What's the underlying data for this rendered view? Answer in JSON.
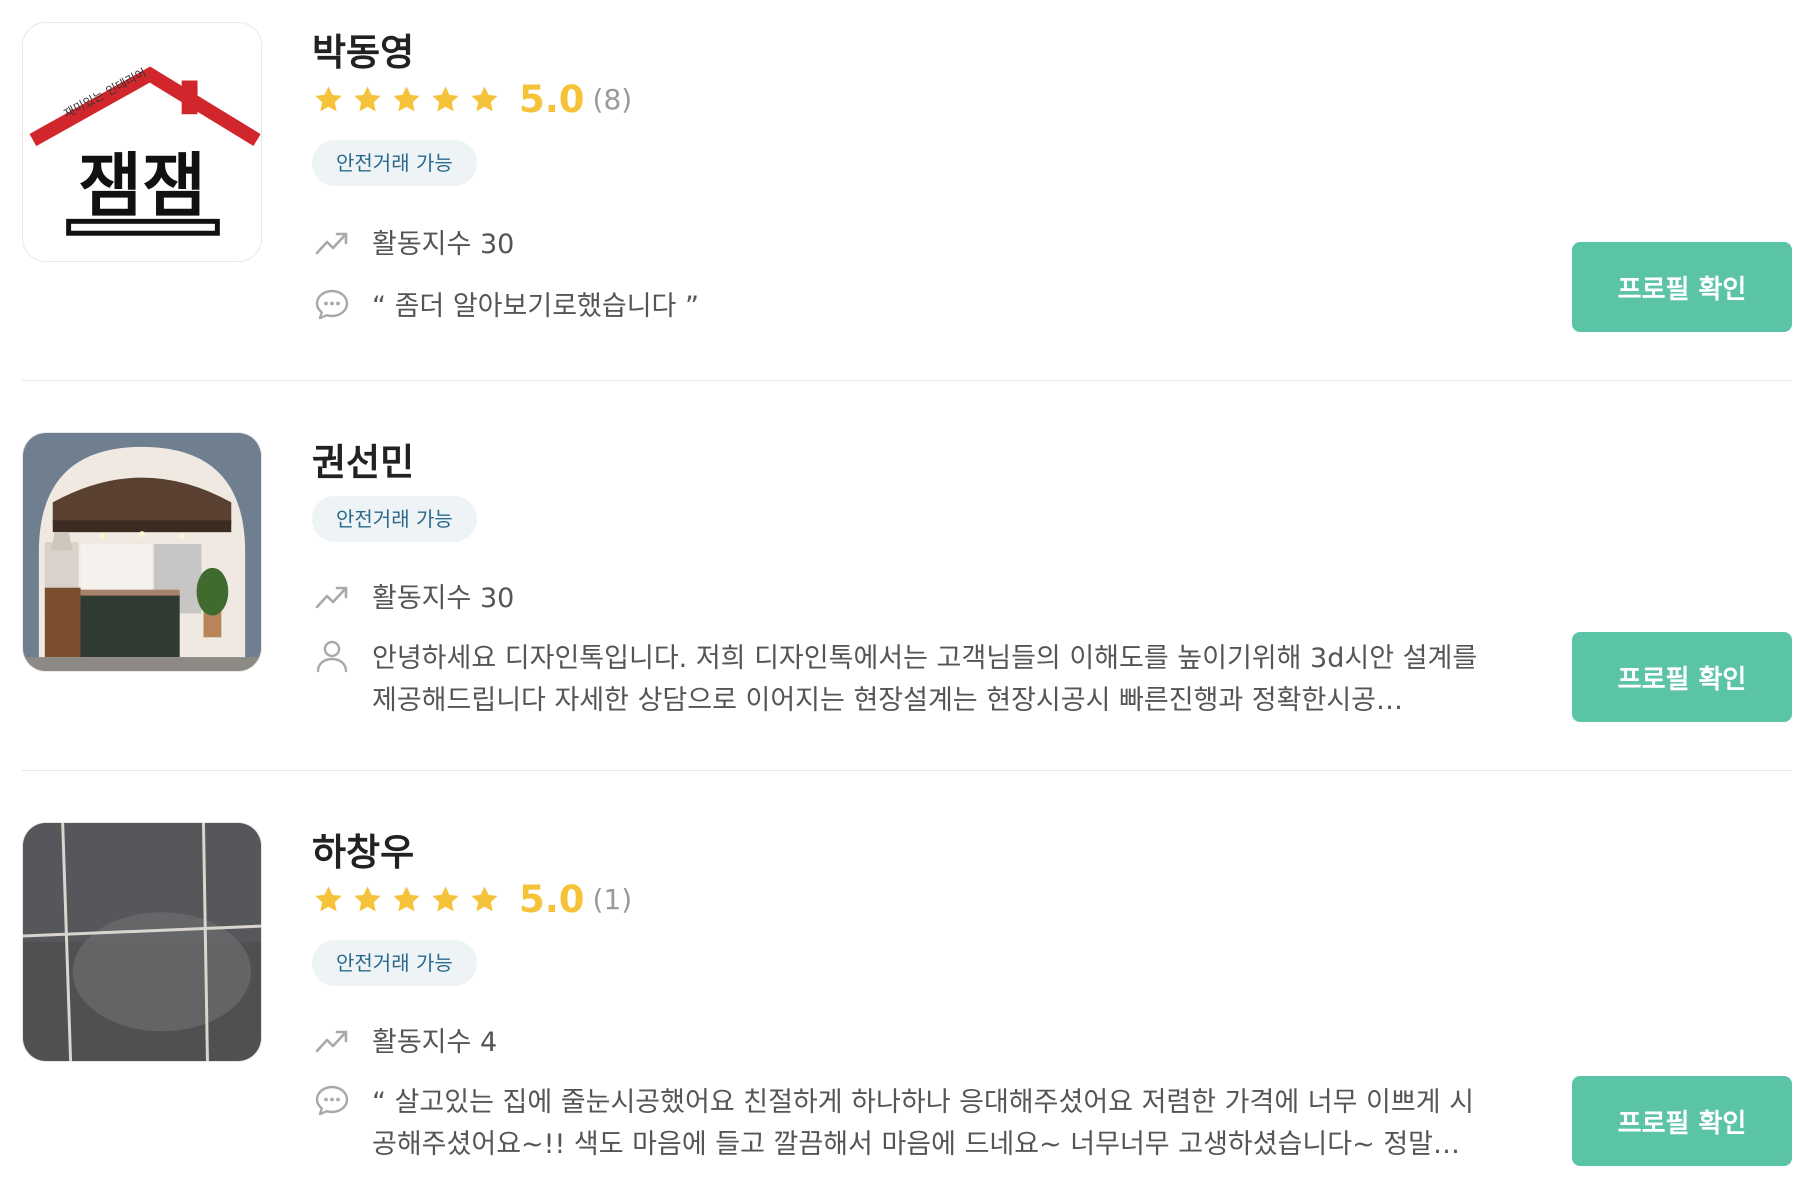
{
  "colors": {
    "accent_button": "#5cc4a6",
    "star": "#f5c23a",
    "badge_bg": "#eef3f6",
    "badge_text": "#2b6a8c",
    "divider": "#e6e6e6"
  },
  "experts": [
    {
      "name": "박동영",
      "avatar_icon": "jaemjaem-house-logo",
      "avatar_logo_text": "잼잼",
      "avatar_logo_subtext": "재미있는 인테리어",
      "rating": {
        "score": "5.0",
        "count": "(8)",
        "stars": 5
      },
      "badge": "안전거래 가능",
      "activity_icon": "trend-up-icon",
      "activity": "활동지수 30",
      "comment_icon": "chat-bubble-icon",
      "comment": "“ 좀더 알아보기로했습니다 ”",
      "button": "프로필 확인"
    },
    {
      "name": "권선민",
      "avatar_icon": "kitchen-interior-photo",
      "badge": "안전거래 가능",
      "activity_icon": "trend-up-icon",
      "activity": "활동지수 30",
      "comment_icon": "person-icon",
      "comment": "안녕하세요 디자인톡입니다. 저희 디자인톡에서는 고객님들의 이해도를 높이기위해 3d시안 설계를 제공해드립니다 자세한 상담으로 이어지는 현장설계는 현장시공시 빠른진행과 정확한시공…",
      "button": "프로필 확인"
    },
    {
      "name": "하창우",
      "avatar_icon": "gray-tile-photo",
      "rating": {
        "score": "5.0",
        "count": "(1)",
        "stars": 5
      },
      "badge": "안전거래 가능",
      "activity_icon": "trend-up-icon",
      "activity": "활동지수 4",
      "comment_icon": "chat-bubble-icon",
      "comment": "“ 살고있는 집에 줄눈시공했어요 친절하게 하나하나 응대해주셨어요 저렴한 가격에 너무 이쁘게 시공해주셨어요~!! 색도 마음에 들고 깔끔해서 마음에 드네요~ 너무너무 고생하셨습니다~ 정말…",
      "button": "프로필 확인"
    }
  ]
}
